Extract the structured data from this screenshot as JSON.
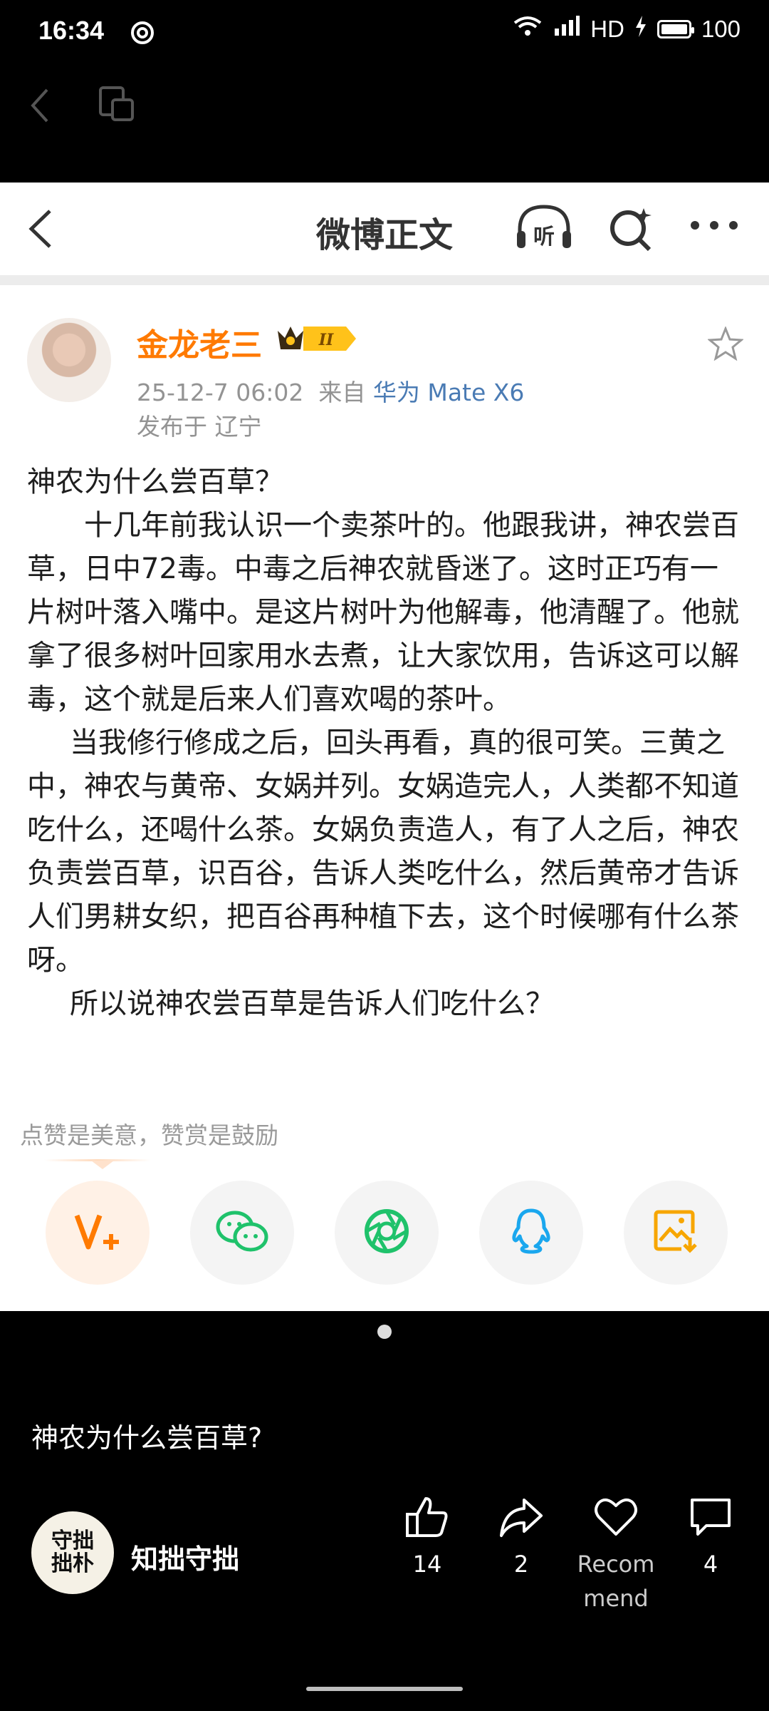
{
  "status_bar": {
    "time": "16:34",
    "network": "HD",
    "battery": "100",
    "battery_level": 1.0
  },
  "weibo": {
    "header_title": "微博正文",
    "listen_label": "听",
    "author": "金龙老三",
    "vip_level": "II",
    "post_time": "25-12-7 06:02",
    "source_prefix": "来自",
    "device": "华为 Mate X6",
    "location": "发布于 辽宁",
    "paragraphs": [
      "神农为什么尝百草？",
      "十几年前我认识一个卖茶叶的。他跟我讲，神农尝百草，日中72毒。中毒之后神农就昏迷了。这时正巧有一片树叶落入嘴中。是这片树叶为他解毒，他清醒了。他就拿了很多树叶回家用水去煮，让大家饮用，告诉这可以解毒，这个就是后来人们喜欢喝的茶叶。",
      "当我修行修成之后，回头再看，真的很可笑。三黄之中，神农与黄帝、女娲并列。女娲造完人，人类都不知道吃什么，还喝什么茶。女娲负责造人，有了人之后，神农负责尝百草，识百谷，告诉人类吃什么，然后黄帝才告诉人们男耕女织，把百谷再种植下去，这个时候哪有什么茶呀。",
      "所以说神农尝百草是告诉人们吃什么？"
    ],
    "appreciate_text": "点赞是美意，赞赏是鼓励",
    "share_icons": [
      "weibo-reward-icon",
      "wechat-icon",
      "moments-icon",
      "qq-icon",
      "save-image-icon"
    ],
    "colors": {
      "author": "#ff7a00",
      "device": "#4a7bb4",
      "wechat": "#1fc26b",
      "qq": "#1aa7ee",
      "save": "#f7a600"
    }
  },
  "viewer": {
    "caption": "神农为什么尝百草?",
    "channel_avatar_text": "守拙 拙朴",
    "channel_name": "知拙守拙",
    "actions": [
      {
        "name": "like",
        "label": "14"
      },
      {
        "name": "share",
        "label": "2"
      },
      {
        "name": "recommend",
        "label": "Recom mend"
      },
      {
        "name": "comment",
        "label": "4"
      }
    ]
  }
}
